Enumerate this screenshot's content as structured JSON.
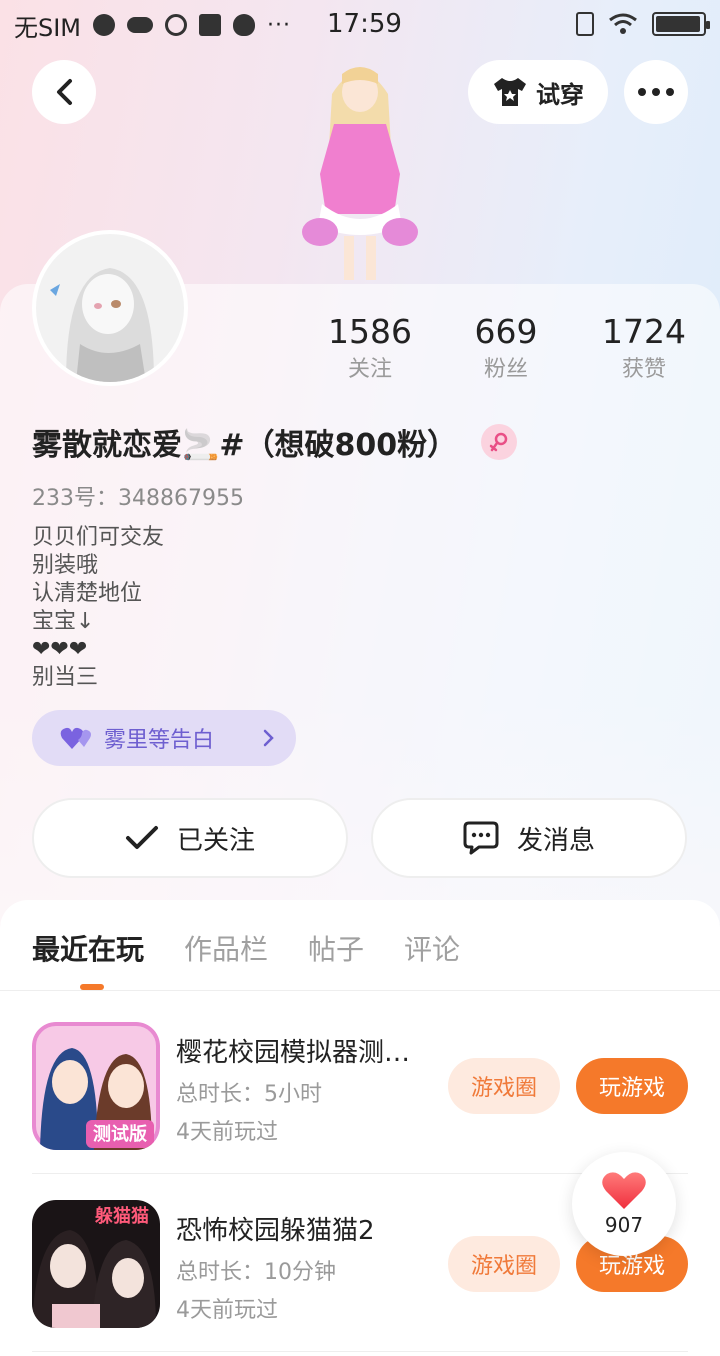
{
  "statusbar": {
    "carrier": "无SIM",
    "time": "17:59",
    "overflow": "···",
    "battery_level": 0.95
  },
  "header": {
    "back_icon": "chevron-left-icon",
    "tryon_icon": "tshirt-icon",
    "tryon_label": "试穿",
    "more_icon": "more-dots-icon"
  },
  "profile": {
    "nickname": "雾散就恋爱🚬#（想破800粉）",
    "gender_icon": "female-icon",
    "uid": "233号：348867955",
    "bio": [
      "贝贝们可交友",
      "别装哦",
      "认清楚地位",
      "宝宝↓",
      "❤❤❤",
      "别当三"
    ],
    "stats": [
      {
        "value": "1586",
        "label": "关注"
      },
      {
        "value": "669",
        "label": "粉丝"
      },
      {
        "value": "1724",
        "label": "获赞"
      }
    ],
    "confess_chip": "雾里等告白"
  },
  "actions": {
    "follow_label": "已关注",
    "message_label": "发消息"
  },
  "tabs": [
    "最近在玩",
    "作品栏",
    "帖子",
    "评论"
  ],
  "games": [
    {
      "title": "樱花校园模拟器测…",
      "duration": "总时长：5小时",
      "last_played": "4天前玩过",
      "circle_label": "游戏圈",
      "play_label": "玩游戏",
      "badge": "测试版"
    },
    {
      "title": "恐怖校园躲猫猫2",
      "duration": "总时长：10分钟",
      "last_played": "4天前玩过",
      "circle_label": "游戏圈",
      "play_label": "玩游戏",
      "badge": "躲猫猫"
    }
  ],
  "like_float": {
    "icon": "heart-icon",
    "count": "907"
  },
  "colors": {
    "accent_orange": "#f5792a",
    "chip_purple": "#6e5fd0"
  }
}
